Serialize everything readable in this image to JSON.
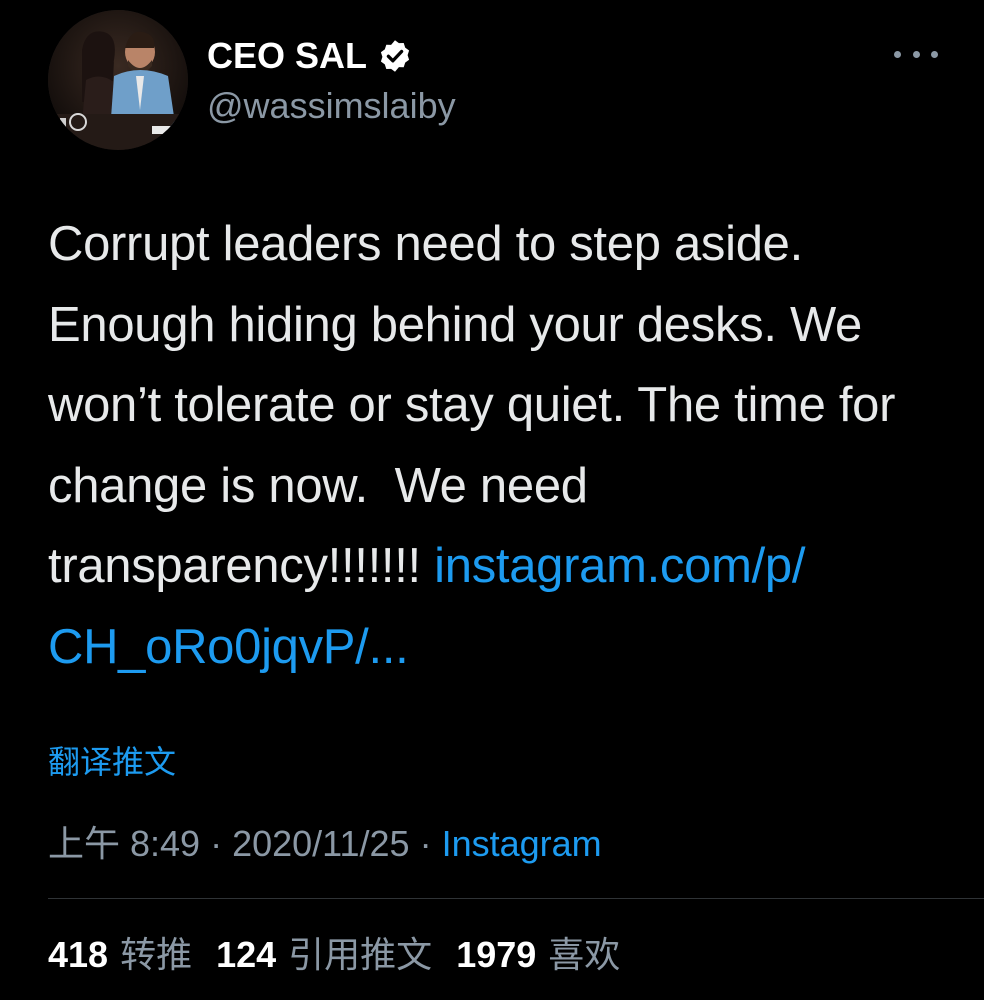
{
  "user": {
    "display_name": "CEO SAL",
    "handle": "@wassimslaiby",
    "verified": true
  },
  "tweet": {
    "text": "Corrupt leaders need to step aside. Enough hiding behind your desks. We won’t tolerate or stay quiet. The time for change is now.  We need transparency!!!!!!! ",
    "link_text": "instagram.com/p/\nCH_oRo0jqvP/...",
    "translate_label": "翻译推文"
  },
  "meta": {
    "time": "上午 8:49",
    "separator": "·",
    "date": "2020/11/25",
    "source": "Instagram"
  },
  "stats": {
    "retweets_count": "418",
    "retweets_label": "转推",
    "quotes_count": "124",
    "quotes_label": "引用推文",
    "likes_count": "1979",
    "likes_label": "喜欢"
  },
  "icons": {
    "verified": "verified-badge-icon",
    "more": "more-options-icon"
  },
  "colors": {
    "background": "#000000",
    "link": "#1d9bf0",
    "secondary_text": "#8b98a5",
    "primary_text": "#e7e9ea"
  }
}
